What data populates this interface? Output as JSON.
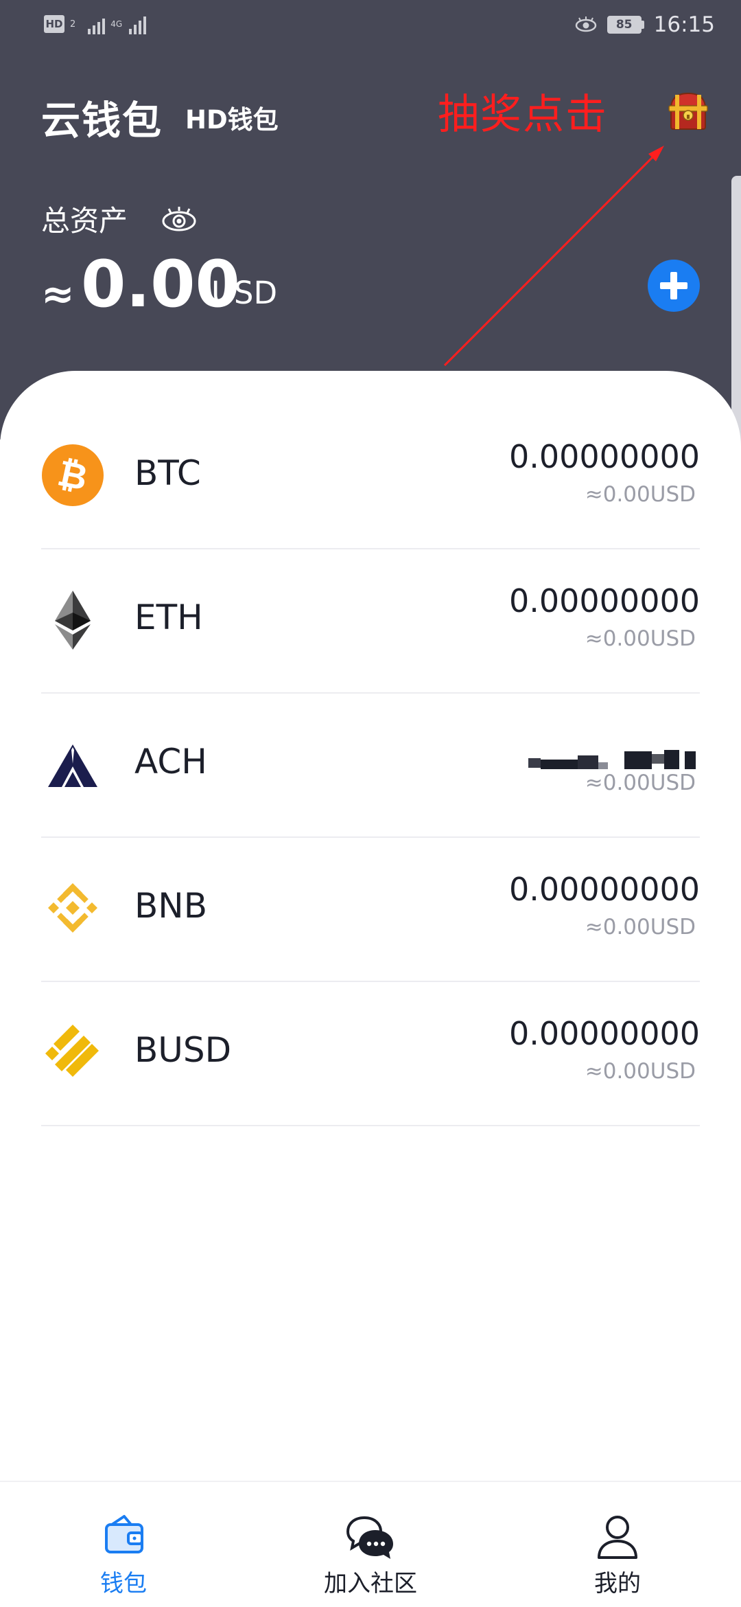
{
  "status_bar": {
    "hd_badge": "HD",
    "hd_sub": "2",
    "network": "4G",
    "battery": "85",
    "time": "16:15"
  },
  "header": {
    "title": "云钱包",
    "wallet_type": "HD钱包",
    "annotation": "抽奖点击",
    "assets_label": "总资产",
    "approx_symbol": "≈",
    "total_value": "0.00",
    "total_unit": "USD"
  },
  "tokens": [
    {
      "symbol": "BTC",
      "amount": "0.00000000",
      "fiat": "≈0.00USD",
      "icon": "bitcoin-icon",
      "color": "#f7931a"
    },
    {
      "symbol": "ETH",
      "amount": "0.00000000",
      "fiat": "≈0.00USD",
      "icon": "ethereum-icon",
      "color": "#3c3c3d"
    },
    {
      "symbol": "ACH",
      "amount": "",
      "fiat": "≈0.00USD",
      "icon": "alchemy-pay-icon",
      "color": "#1b1d4d"
    },
    {
      "symbol": "BNB",
      "amount": "0.00000000",
      "fiat": "≈0.00USD",
      "icon": "bnb-icon",
      "color": "#f3ba2f"
    },
    {
      "symbol": "BUSD",
      "amount": "0.00000000",
      "fiat": "≈0.00USD",
      "icon": "busd-icon",
      "color": "#f0b90b"
    }
  ],
  "nav": {
    "wallet": "钱包",
    "community": "加入社区",
    "mine": "我的"
  },
  "colors": {
    "header_bg": "#474856",
    "accent": "#1a7df2",
    "annotation": "#ff1e1e"
  }
}
